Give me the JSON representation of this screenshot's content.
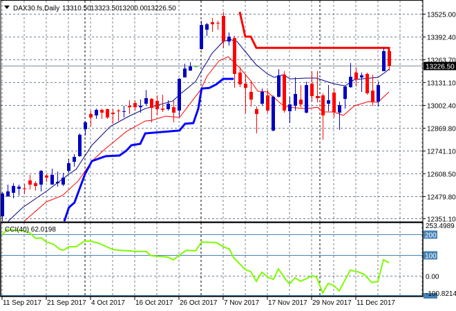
{
  "header": {
    "menu_icon": "triangle-down-icon",
    "symbol": "DAX30.fs,Daily",
    "open": "13310.50",
    "high": "13323.50",
    "low": "13200.00",
    "close": "13226.50"
  },
  "colors": {
    "bull": "#0000c0",
    "bear": "#ff0000",
    "doji": "#00ff00",
    "ma_fast": "#000080",
    "ma_slow": "#ff0000",
    "channel_low": "#0000ff",
    "channel_high": "#ff0000",
    "cci": "#7cfc00",
    "level": "#4682b4",
    "grid": "#708090"
  },
  "chart_data": [
    {
      "type": "candlestick",
      "title": "DAX30.fs,Daily",
      "ylim": [
        12351.1,
        13525.0
      ],
      "y_ticks": [
        "13525.00",
        "13392.40",
        "13263.70",
        "13131.10",
        "13002.40",
        "12869.80",
        "12741.10",
        "12608.50",
        "12479.80",
        "12351.10"
      ],
      "current_price_label": "13226.50",
      "current_price": 13226.5,
      "x_tick_labels": [
        {
          "index": 0,
          "label": "11 Sep 2017"
        },
        {
          "index": 8,
          "label": "21 Sep 2017"
        },
        {
          "index": 16,
          "label": "4 Oct 2017"
        },
        {
          "index": 24,
          "label": "16 Oct 2017"
        },
        {
          "index": 32,
          "label": "26 Oct 2017"
        },
        {
          "index": 40,
          "label": "7 Nov 2017"
        },
        {
          "index": 48,
          "label": "17 Nov 2017"
        },
        {
          "index": 56,
          "label": "29 Nov 2017"
        },
        {
          "index": 64,
          "label": "11 Dec 2017"
        }
      ],
      "period_separators": [
        15,
        36,
        57.5
      ],
      "ohlc": [
        [
          12363,
          12502,
          12335,
          12494
        ],
        [
          12478,
          12545,
          12474,
          12506
        ],
        [
          12498,
          12553,
          12466,
          12537
        ],
        [
          12521,
          12545,
          12482,
          12533
        ],
        [
          12523,
          12549,
          12490,
          12519
        ],
        [
          12569,
          12601,
          12517,
          12545
        ],
        [
          12553,
          12565,
          12510,
          12537
        ],
        [
          12545,
          12628,
          12506,
          12624
        ],
        [
          12597,
          12605,
          12561,
          12585
        ],
        [
          12545,
          12636,
          12545,
          12601
        ],
        [
          12553,
          12620,
          12533,
          12561
        ],
        [
          12545,
          12613,
          12537,
          12585
        ],
        [
          12624,
          12692,
          12613,
          12668
        ],
        [
          12676,
          12720,
          12648,
          12704
        ],
        [
          12708,
          12839,
          12704,
          12831
        ],
        [
          12863,
          12910,
          12827,
          12902
        ],
        [
          12950,
          12970,
          12879,
          12930
        ],
        [
          12942,
          12981,
          12922,
          12974
        ],
        [
          12974,
          12981,
          12922,
          12958
        ],
        [
          12978,
          12981,
          12922,
          12930
        ],
        [
          12958,
          12978,
          12894,
          12950
        ],
        [
          12970,
          12978,
          12910,
          12966
        ],
        [
          12962,
          12997,
          12930,
          12966
        ],
        [
          12997,
          13029,
          12950,
          12989
        ],
        [
          13013,
          13029,
          12970,
          12989
        ],
        [
          12989,
          13033,
          12958,
          12997
        ],
        [
          13009,
          13088,
          12997,
          13041
        ],
        [
          13037,
          13041,
          12902,
          12985
        ],
        [
          13025,
          13057,
          12942,
          12978
        ],
        [
          12981,
          13061,
          12962,
          12974
        ],
        [
          12978,
          13029,
          12970,
          13009
        ],
        [
          12989,
          13025,
          12902,
          12958
        ],
        [
          12970,
          13156,
          12934,
          13152
        ],
        [
          13160,
          13239,
          13160,
          13211
        ],
        [
          13199,
          13247,
          13199,
          13223
        ],
        [
          13223,
          13225,
          13221,
          13223
        ],
        [
          13323,
          13485,
          13319,
          13461
        ],
        [
          13434,
          13473,
          13398,
          13465
        ],
        [
          13477,
          13501,
          13422,
          13465
        ],
        [
          13473,
          13485,
          13434,
          13469
        ],
        [
          13513,
          13536,
          13327,
          13366
        ],
        [
          13366,
          13418,
          13342,
          13394
        ],
        [
          13386,
          13398,
          13100,
          13180
        ],
        [
          13188,
          13219,
          13104,
          13120
        ],
        [
          13124,
          13180,
          12954,
          13100
        ],
        [
          13077,
          13140,
          12993,
          13033
        ],
        [
          12978,
          12993,
          12839,
          12950
        ],
        [
          13009,
          13096,
          12997,
          13077
        ],
        [
          13057,
          13088,
          12958,
          12970
        ],
        [
          12855,
          13057,
          12851,
          13049
        ],
        [
          13049,
          13207,
          13045,
          13172
        ],
        [
          13176,
          13196,
          12958,
          12970
        ],
        [
          12966,
          13049,
          12898,
          13005
        ],
        [
          12997,
          13160,
          12970,
          13065
        ],
        [
          13033,
          13116,
          12989,
          13005
        ],
        [
          12958,
          13136,
          12954,
          13116
        ],
        [
          13124,
          13196,
          13021,
          13053
        ],
        [
          13053,
          13196,
          13017,
          13041
        ],
        [
          13057,
          13069,
          12803,
          12942
        ],
        [
          13009,
          13116,
          12966,
          13029
        ],
        [
          13073,
          13096,
          12930,
          12962
        ],
        [
          12958,
          13021,
          12859,
          13001
        ],
        [
          13037,
          13112,
          12981,
          13108
        ],
        [
          13104,
          13243,
          13100,
          13164
        ],
        [
          13188,
          13215,
          13108,
          13148
        ],
        [
          13160,
          13188,
          13077,
          13172
        ],
        [
          13180,
          13188,
          13061,
          13069
        ],
        [
          13084,
          13176,
          12997,
          13021
        ],
        [
          13021,
          13136,
          12993,
          13116
        ],
        [
          13196,
          13330,
          13196,
          13311
        ],
        [
          13310.5,
          13323.5,
          13200,
          13226.5
        ]
      ],
      "series": [
        {
          "name": "ma-fast",
          "width": 1,
          "points": [
            [
              1.1,
              12335
            ],
            [
              3.75,
              12414
            ],
            [
              8,
              12506
            ],
            [
              12.1,
              12605
            ],
            [
              13.4,
              12633
            ],
            [
              16.25,
              12771
            ],
            [
              19.6,
              12879
            ],
            [
              23,
              12938
            ],
            [
              25.9,
              12981
            ],
            [
              30.9,
              13025
            ],
            [
              32.1,
              13061
            ],
            [
              35,
              13136
            ],
            [
              36.25,
              13207
            ],
            [
              38,
              13299
            ],
            [
              40,
              13366
            ],
            [
              41.25,
              13378
            ],
            [
              42.5,
              13366
            ],
            [
              44.25,
              13299
            ],
            [
              45.9,
              13235
            ],
            [
              48,
              13180
            ],
            [
              49.25,
              13160
            ],
            [
              50.9,
              13176
            ],
            [
              52.1,
              13152
            ],
            [
              55,
              13156
            ],
            [
              56.9,
              13156
            ],
            [
              58.4,
              13140
            ],
            [
              60,
              13124
            ],
            [
              61.25,
              13116
            ],
            [
              62.1,
              13112
            ],
            [
              63.75,
              13148
            ],
            [
              68,
              13160
            ],
            [
              69.25,
              13188
            ],
            [
              70,
              13207
            ]
          ]
        },
        {
          "name": "ma-slow",
          "width": 1,
          "points": [
            [
              4,
              12335
            ],
            [
              8,
              12446
            ],
            [
              10.9,
              12482
            ],
            [
              13.75,
              12565
            ],
            [
              16.25,
              12680
            ],
            [
              18.4,
              12743
            ],
            [
              22.5,
              12850
            ],
            [
              25.9,
              12910
            ],
            [
              27.1,
              12914
            ],
            [
              29.6,
              12938
            ],
            [
              32.1,
              12930
            ],
            [
              35.9,
              13088
            ],
            [
              37.1,
              13168
            ],
            [
              39.25,
              13255
            ],
            [
              40.9,
              13279
            ],
            [
              43,
              13215
            ],
            [
              45,
              13140
            ],
            [
              46.25,
              13081
            ],
            [
              48,
              13077
            ],
            [
              50.9,
              12997
            ],
            [
              52.1,
              12989
            ],
            [
              55,
              12981
            ],
            [
              57.1,
              12989
            ],
            [
              58,
              12962
            ],
            [
              60,
              12962
            ],
            [
              61.75,
              12942
            ],
            [
              63.75,
              12997
            ],
            [
              66.25,
              13021
            ],
            [
              68,
              13017
            ],
            [
              70,
              13077
            ]
          ]
        },
        {
          "name": "channel-low",
          "width": 3,
          "points": [
            [
              11.25,
              12335
            ],
            [
              12.1,
              12414
            ],
            [
              13.1,
              12442
            ],
            [
              15,
              12605
            ],
            [
              16.25,
              12680
            ],
            [
              18.75,
              12708
            ],
            [
              21.25,
              12712
            ],
            [
              22.5,
              12740
            ],
            [
              23.4,
              12771
            ],
            [
              25,
              12779
            ],
            [
              25.9,
              12839
            ],
            [
              32.1,
              12855
            ],
            [
              33.1,
              12894
            ],
            [
              34.6,
              12898
            ],
            [
              35.5,
              12981
            ],
            [
              36.1,
              13096
            ],
            [
              37.5,
              13100
            ],
            [
              38.75,
              13120
            ],
            [
              40,
              13152
            ],
            [
              41.9,
              13152
            ]
          ]
        },
        {
          "name": "channel-high",
          "width": 3,
          "points": [
            [
              43,
              13536
            ],
            [
              44,
              13394
            ],
            [
              45,
              13394
            ],
            [
              46,
              13330
            ],
            [
              70,
              13330
            ],
            [
              70,
              13302
            ]
          ]
        }
      ]
    },
    {
      "type": "line",
      "title": "CCI(40) 62.0198",
      "label": "CCI(40)",
      "last_value": "62.0198",
      "ylim": [
        -100.8214,
        253.4989
      ],
      "y_tick_labels": [
        "253.4989",
        "200",
        "100",
        "0.00",
        "-100.8214"
      ],
      "levels": [
        200,
        100,
        -100
      ],
      "points": [
        [
          0,
          197
        ],
        [
          0.9,
          223
        ],
        [
          3.75,
          217
        ],
        [
          5,
          207
        ],
        [
          6.1,
          180
        ],
        [
          7.1,
          183
        ],
        [
          8,
          163
        ],
        [
          9.25,
          153
        ],
        [
          10.5,
          127
        ],
        [
          11.1,
          123
        ],
        [
          12.1,
          140
        ],
        [
          13.4,
          140
        ],
        [
          14.9,
          167
        ],
        [
          16.1,
          167
        ],
        [
          17.5,
          157
        ],
        [
          20,
          127
        ],
        [
          21.1,
          123
        ],
        [
          23,
          120
        ],
        [
          24.25,
          117
        ],
        [
          26.1,
          117
        ],
        [
          26.9,
          97
        ],
        [
          28.75,
          93
        ],
        [
          30,
          90
        ],
        [
          31,
          77
        ],
        [
          31.9,
          97
        ],
        [
          33.4,
          123
        ],
        [
          35,
          120
        ],
        [
          36.1,
          163
        ],
        [
          38.75,
          160
        ],
        [
          40.25,
          137
        ],
        [
          41.1,
          130
        ],
        [
          41.9,
          87
        ],
        [
          44,
          30
        ],
        [
          45,
          20
        ],
        [
          46,
          -27
        ],
        [
          47,
          17
        ],
        [
          48.1,
          -7
        ],
        [
          49.1,
          -17
        ],
        [
          50,
          33
        ],
        [
          51.1,
          -10
        ],
        [
          52,
          -40
        ],
        [
          53,
          -10
        ],
        [
          54,
          -27
        ],
        [
          56.1,
          0
        ],
        [
          56.9,
          -7
        ],
        [
          58,
          -83
        ],
        [
          59,
          -37
        ],
        [
          60,
          -47
        ],
        [
          61,
          -73
        ],
        [
          63,
          27
        ],
        [
          64.25,
          20
        ],
        [
          65.5,
          7
        ],
        [
          66.9,
          -33
        ],
        [
          68,
          -27
        ],
        [
          69,
          77
        ],
        [
          70,
          62
        ]
      ]
    }
  ]
}
